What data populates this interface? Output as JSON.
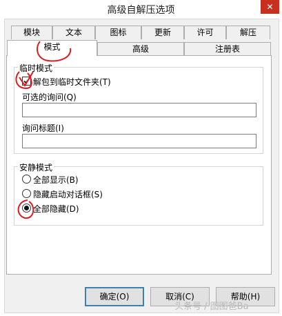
{
  "window": {
    "title": "高级自解压选项",
    "close_glyph": "✕"
  },
  "tabs_row1": [
    {
      "label": "模块"
    },
    {
      "label": "文本"
    },
    {
      "label": "图标"
    },
    {
      "label": "更新"
    },
    {
      "label": "许可"
    },
    {
      "label": "解压"
    }
  ],
  "tabs_row2": [
    {
      "label": "模式",
      "active": true
    },
    {
      "label": "高级",
      "active": false
    },
    {
      "label": "注册表",
      "active": false
    }
  ],
  "temp_mode": {
    "group_title": "临时模式",
    "unpack_checkbox": {
      "label": "解包到临时文件夹(T)",
      "checked": true
    },
    "optional_query_label": "可选的询问(Q)",
    "optional_query_value": "",
    "query_title_label": "询问标题(I)",
    "query_title_value": ""
  },
  "silent_mode": {
    "group_title": "安静模式",
    "options": [
      {
        "label": "全部显示(B)",
        "checked": false
      },
      {
        "label": "隐藏启动对话框(S)",
        "checked": false
      },
      {
        "label": "全部隐藏(D)",
        "checked": true
      }
    ]
  },
  "buttons": {
    "ok": "确定(O)",
    "cancel": "取消(C)",
    "help": "帮助(H)"
  },
  "watermark": "头条号 / 图图爸Ba",
  "colors": {
    "close_button": "#c7301f",
    "annotation_red": "#e0191e",
    "default_button_border": "#3c7fb1"
  }
}
